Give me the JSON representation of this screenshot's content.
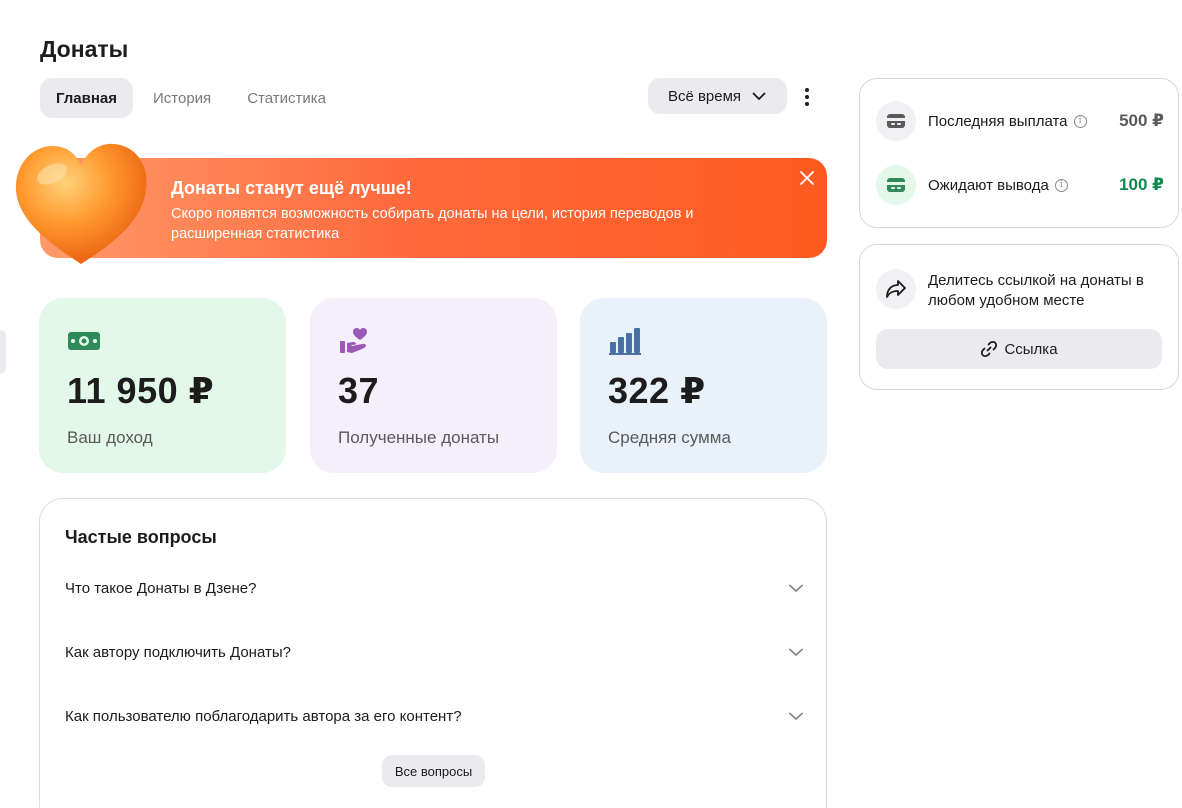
{
  "header": {
    "title": "Донаты",
    "tabs": [
      {
        "label": "Главная",
        "active": true
      },
      {
        "label": "История",
        "active": false
      },
      {
        "label": "Статистика",
        "active": false
      }
    ],
    "period_label": "Всё время"
  },
  "banner": {
    "title": "Донаты станут ещё лучше!",
    "text": "Скоро появятся возможность собирать донаты на цели, история переводов и расширенная статистика",
    "icon": "heart-icon",
    "gradient_start": "#ff9a6a",
    "gradient_end": "#ff5a1f"
  },
  "stats": [
    {
      "value": "11 950 ₽",
      "label": "Ваш доход",
      "icon": "money-icon",
      "color": "#e4f8ea"
    },
    {
      "value": "37",
      "label": "Полученные донаты",
      "icon": "donate-hand-icon",
      "color": "#f5eefb"
    },
    {
      "value": "322 ₽",
      "label": "Средняя сумма",
      "icon": "bar-chart-icon",
      "color": "#e9f1fb"
    }
  ],
  "faq": {
    "title": "Частые вопросы",
    "items": [
      {
        "question": "Что такое Донаты в Дзене?"
      },
      {
        "question": "Как автору подключить Донаты?"
      },
      {
        "question": "Как пользователю поблагодарить автора за его контент?"
      }
    ],
    "all_label": "Все вопросы"
  },
  "payouts": {
    "last": {
      "label": "Последняя выплата",
      "value": "500 ₽",
      "color": "#5a5a5a"
    },
    "pending": {
      "label": "Ожидают вывода",
      "value": "100 ₽",
      "color": "#0f8a4a"
    }
  },
  "share": {
    "text": "Делитесь ссылкой на донаты в любом удобном месте",
    "button_label": "Ссылка"
  }
}
